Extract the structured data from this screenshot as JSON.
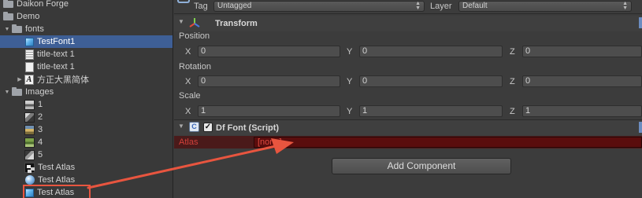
{
  "project_panel": {
    "items": [
      {
        "label": "Daikon Forge",
        "icon": "folder-icon"
      },
      {
        "label": "Demo",
        "icon": "folder-icon"
      },
      {
        "label": "fonts",
        "icon": "folder-icon"
      },
      {
        "label": "TestFont1",
        "icon": "prefab-cube-icon"
      },
      {
        "label": "title-text 1",
        "icon": "text-asset-icon"
      },
      {
        "label": "title-text 1",
        "icon": "blank-document-icon"
      },
      {
        "label": "方正大黑简体",
        "icon": "font-asset-icon"
      },
      {
        "label": "Images",
        "icon": "folder-icon"
      },
      {
        "label": "1",
        "icon": "image-thumbnail-icon"
      },
      {
        "label": "2",
        "icon": "image-thumbnail-icon"
      },
      {
        "label": "3",
        "icon": "image-thumbnail-icon"
      },
      {
        "label": "4",
        "icon": "image-thumbnail-icon"
      },
      {
        "label": "5",
        "icon": "image-thumbnail-icon"
      },
      {
        "label": "Test Atlas",
        "icon": "atlas-texture-icon"
      },
      {
        "label": "Test Atlas",
        "icon": "material-sphere-icon"
      },
      {
        "label": "Test Atlas",
        "icon": "prefab-cube-icon"
      }
    ],
    "selected_item": "TestFont1"
  },
  "inspector": {
    "tag_label": "Tag",
    "tag_value": "Untagged",
    "layer_label": "Layer",
    "layer_value": "Default",
    "transform": {
      "title": "Transform",
      "position_label": "Position",
      "rotation_label": "Rotation",
      "scale_label": "Scale",
      "axis_x": "X",
      "axis_y": "Y",
      "axis_z": "Z",
      "position": {
        "x": "0",
        "y": "0",
        "z": "0"
      },
      "rotation": {
        "x": "0",
        "y": "0",
        "z": "0"
      },
      "scale": {
        "x": "1",
        "y": "1",
        "z": "1"
      }
    },
    "df_font": {
      "title": "Df Font (Script)",
      "enabled": true,
      "checkmark": "✓",
      "atlas_label": "Atlas",
      "atlas_value": "[none]"
    },
    "add_component_label": "Add Component"
  },
  "colors": {
    "selection_blue": "#3e5f96",
    "missing_field_red": "#5a0d0d",
    "annotation_red": "#e8553f"
  }
}
